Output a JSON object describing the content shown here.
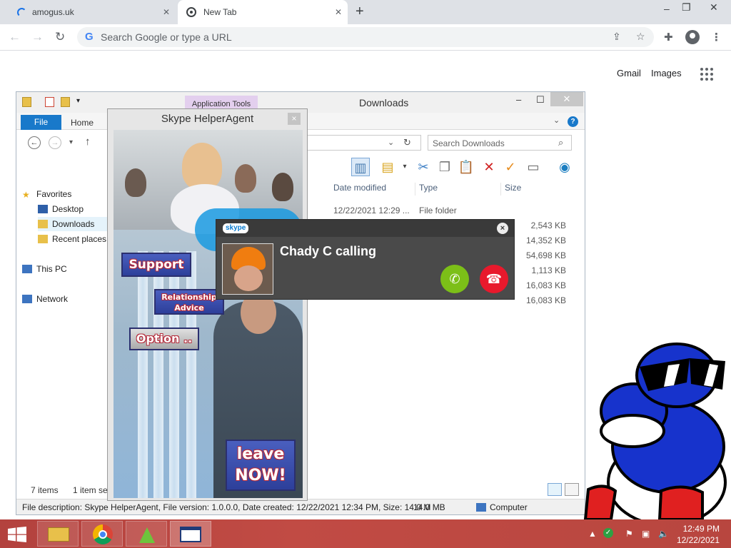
{
  "browser": {
    "tabs": [
      {
        "title": "amogus.uk",
        "loading": true
      },
      {
        "title": "New Tab",
        "active": true
      }
    ],
    "new_tab_symbol": "+",
    "window_controls": {
      "minimize": "–",
      "restore": "❐",
      "close": "✕"
    },
    "nav": {
      "back": "←",
      "forward": "→",
      "reload": "↻"
    },
    "omnibox": {
      "placeholder": "Search Google or type a URL",
      "value": "",
      "google_mark": "G"
    },
    "toolbar_icons": [
      "share-icon",
      "star-icon",
      "extensions-icon",
      "profile-icon",
      "menu-icon"
    ],
    "ntp_links": {
      "gmail": "Gmail",
      "images": "Images"
    }
  },
  "explorer": {
    "title": "Downloads",
    "contextual_tab": "Application Tools",
    "ribbon_tabs": {
      "file": "File",
      "home": "Home"
    },
    "search_placeholder": "Search Downloads",
    "columns": {
      "date": "Date modified",
      "type": "Type",
      "size": "Size"
    },
    "rows": [
      {
        "date": "12/22/2021 12:29 ...",
        "type": "File folder",
        "size": ""
      },
      {
        "date": "",
        "type": "",
        "size": "2,543 KB"
      },
      {
        "date": "",
        "type": "",
        "size": "14,352 KB"
      },
      {
        "date": "",
        "type": "",
        "size": "54,698 KB"
      },
      {
        "date": "",
        "type": "",
        "size": "1,113 KB"
      },
      {
        "date": "",
        "type": "",
        "size": "16,083 KB"
      },
      {
        "date": "",
        "type": "",
        "size": "16,083 KB"
      }
    ],
    "nav_pane": {
      "favorites": "Favorites",
      "desktop": "Desktop",
      "downloads": "Downloads",
      "recent": "Recent places",
      "this_pc": "This PC",
      "network": "Network"
    },
    "status": {
      "items": "7 items",
      "selected": "1 item sel"
    },
    "description_bar": {
      "text": "File description: Skype HelperAgent, File version: 1.0.0.0, Date created: 12/22/2021 12:34 PM, Size: 14.0 M",
      "size": "14.0 MB",
      "location": "Computer"
    }
  },
  "helper": {
    "title": "Skype HelperAgent",
    "close": "×",
    "buttons": {
      "support": "Support",
      "relationship_line1": "Relationship",
      "relationship_line2": "Advice",
      "option": "Option ..",
      "leave_line1": "leave",
      "leave_line2": "NOW!"
    }
  },
  "call": {
    "brand": "skype",
    "caller": "Chady C calling",
    "close": "×",
    "accept_icon": "phone-accept-icon",
    "decline_icon": "phone-decline-icon",
    "colors": {
      "accept": "#7cbf18",
      "decline": "#e8192c"
    }
  },
  "taskbar": {
    "time": "12:49 PM",
    "date": "12/22/2021",
    "apps": [
      "file-explorer-icon",
      "chrome-icon",
      "amogus-app-icon",
      "window-app-icon"
    ],
    "accent": "#b8463f"
  }
}
